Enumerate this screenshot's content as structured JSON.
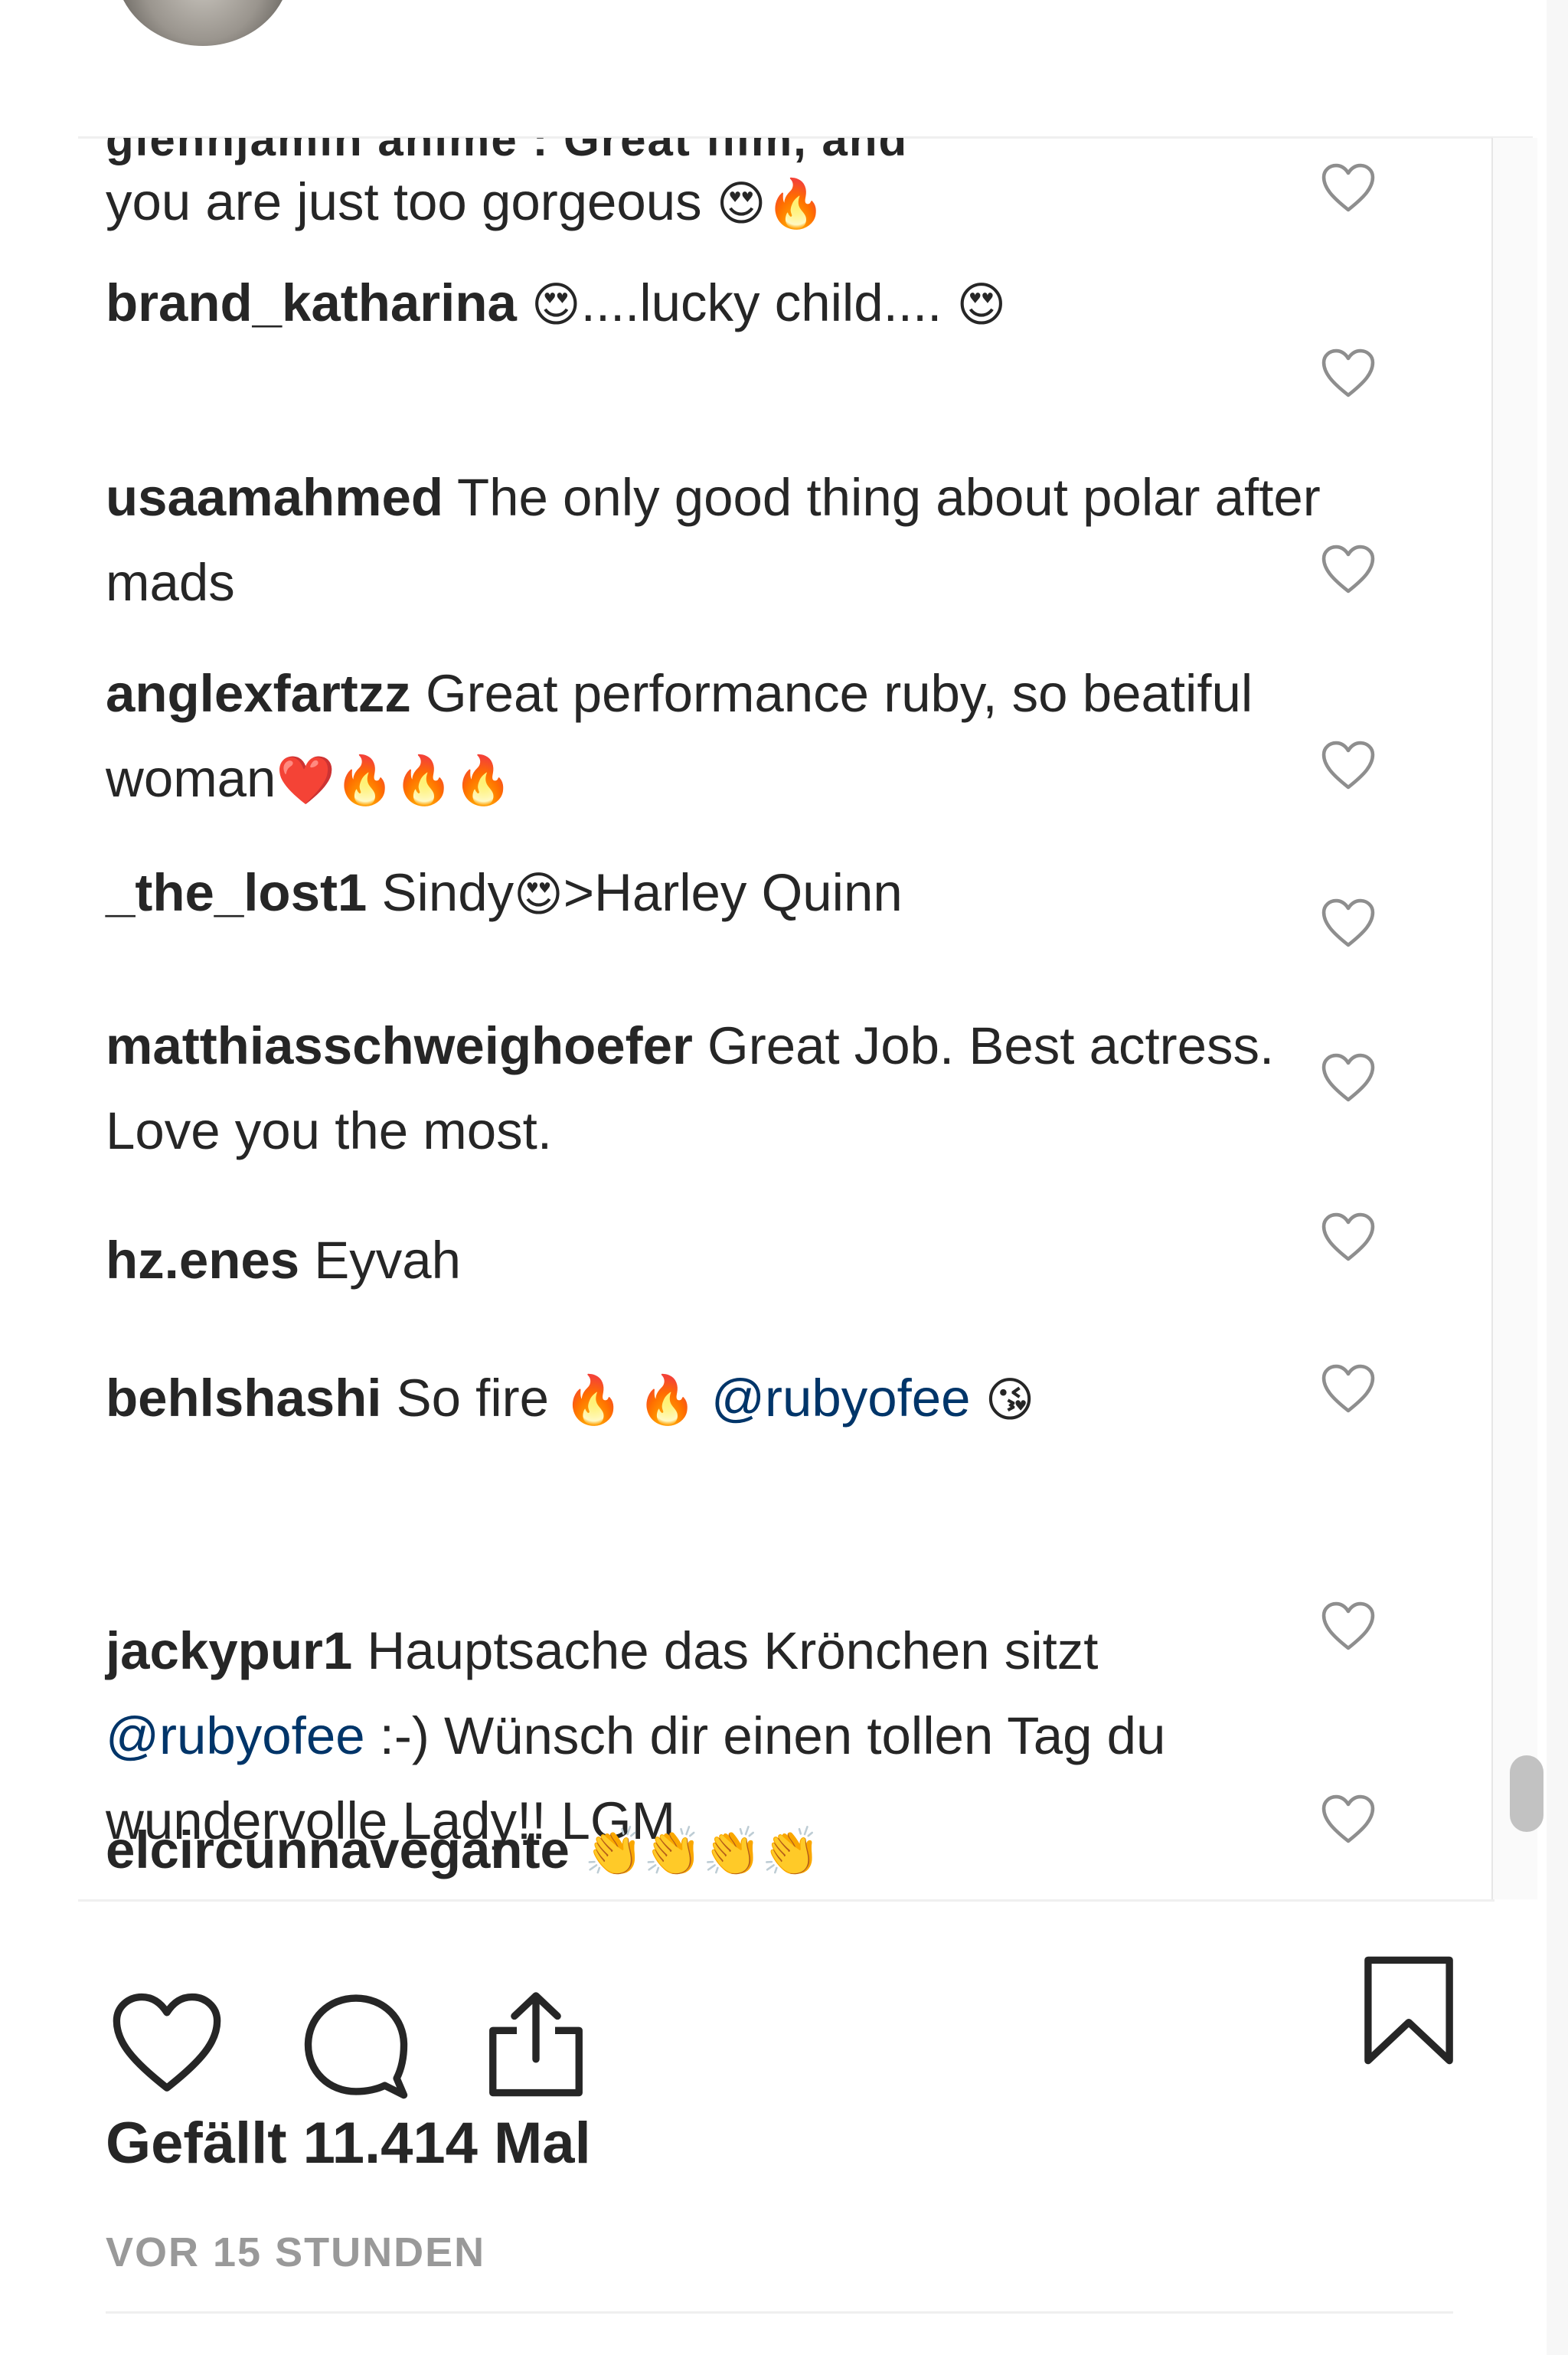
{
  "clipped_top_text": "glennjamin anime : Great film, and",
  "comments": [
    {
      "user": "",
      "parts": [
        {
          "t": "text",
          "v": "you are just too gorgeous "
        },
        {
          "t": "emoji",
          "v": "😍"
        },
        {
          "t": "emoji",
          "v": "🔥"
        }
      ]
    },
    {
      "user": "brand_katharina",
      "parts": [
        {
          "t": "text",
          "v": " "
        },
        {
          "t": "emoji",
          "v": "😍"
        },
        {
          "t": "text",
          "v": "....lucky child.... "
        },
        {
          "t": "emoji",
          "v": "😍"
        }
      ]
    },
    {
      "user": "usaamahmed",
      "parts": [
        {
          "t": "text",
          "v": " The only good thing about polar after mads"
        }
      ]
    },
    {
      "user": "anglexfartzz",
      "parts": [
        {
          "t": "text",
          "v": " Great performance ruby, so beatiful woman"
        },
        {
          "t": "emoji",
          "v": "❤️"
        },
        {
          "t": "emoji",
          "v": "🔥"
        },
        {
          "t": "emoji",
          "v": "🔥"
        },
        {
          "t": "emoji",
          "v": "🔥"
        }
      ]
    },
    {
      "user": "_the_lost1",
      "parts": [
        {
          "t": "text",
          "v": " Sindy"
        },
        {
          "t": "emoji",
          "v": "😍"
        },
        {
          "t": "text",
          "v": ">Harley Quinn"
        }
      ]
    },
    {
      "user": "matthiasschweighoefer",
      "parts": [
        {
          "t": "text",
          "v": " Great Job. Best actress. Love you the most."
        }
      ]
    },
    {
      "user": "hz.enes",
      "parts": [
        {
          "t": "text",
          "v": " Eyvah"
        }
      ]
    },
    {
      "user": "behlshashi",
      "parts": [
        {
          "t": "text",
          "v": " So fire "
        },
        {
          "t": "emoji",
          "v": "🔥"
        },
        {
          "t": "text",
          "v": " "
        },
        {
          "t": "emoji",
          "v": "🔥"
        },
        {
          "t": "text",
          "v": " "
        },
        {
          "t": "mention",
          "v": "@rubyofee"
        },
        {
          "t": "text",
          "v": " "
        },
        {
          "t": "emoji",
          "v": "😘"
        }
      ]
    },
    {
      "user": "jackypur1",
      "parts": [
        {
          "t": "text",
          "v": " Hauptsache das Krönchen sitzt "
        },
        {
          "t": "mention",
          "v": "@rubyofee"
        },
        {
          "t": "text",
          "v": " :-) Wünsch dir einen tollen Tag du wundervolle Lady!! LGM"
        }
      ]
    },
    {
      "user": "elcircunnavegante",
      "parts": [
        {
          "t": "text",
          "v": " "
        },
        {
          "t": "emoji",
          "v": "👏"
        },
        {
          "t": "emoji",
          "v": "👏"
        },
        {
          "t": "emoji",
          "v": "👏"
        },
        {
          "t": "emoji",
          "v": "👏"
        }
      ]
    }
  ],
  "actions": {
    "like_icon": "heart-outline-icon",
    "comment_icon": "comment-bubble-icon",
    "share_icon": "share-upload-icon",
    "save_icon": "bookmark-icon"
  },
  "likes_text": "Gefällt 11.414 Mal",
  "timestamp": "VOR 15 STUNDEN",
  "colors": {
    "text": "#262626",
    "mention": "#003569",
    "muted": "#999999",
    "divider": "#efefef"
  }
}
